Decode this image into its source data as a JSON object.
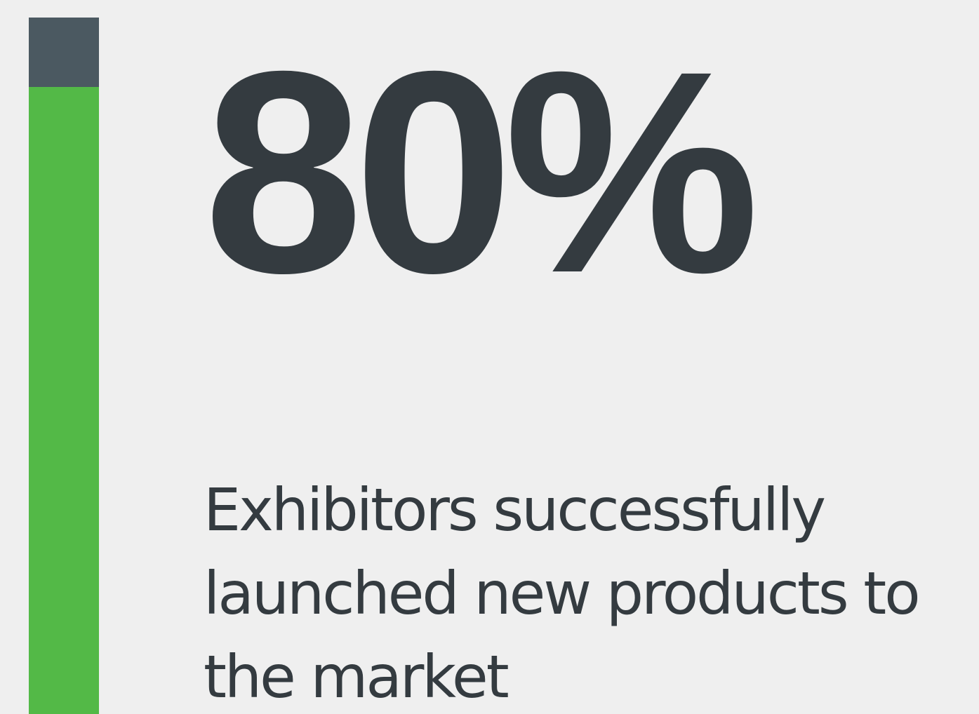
{
  "stat": {
    "value_text": "80%",
    "fraction": 0.9,
    "description_lines": [
      "Exhibitors successfully",
      "launched new products to",
      "the market"
    ]
  },
  "colors": {
    "background": "#efefef",
    "text": "#343b40",
    "bar_fill": "#53b947",
    "bar_track": "#4b5961"
  }
}
